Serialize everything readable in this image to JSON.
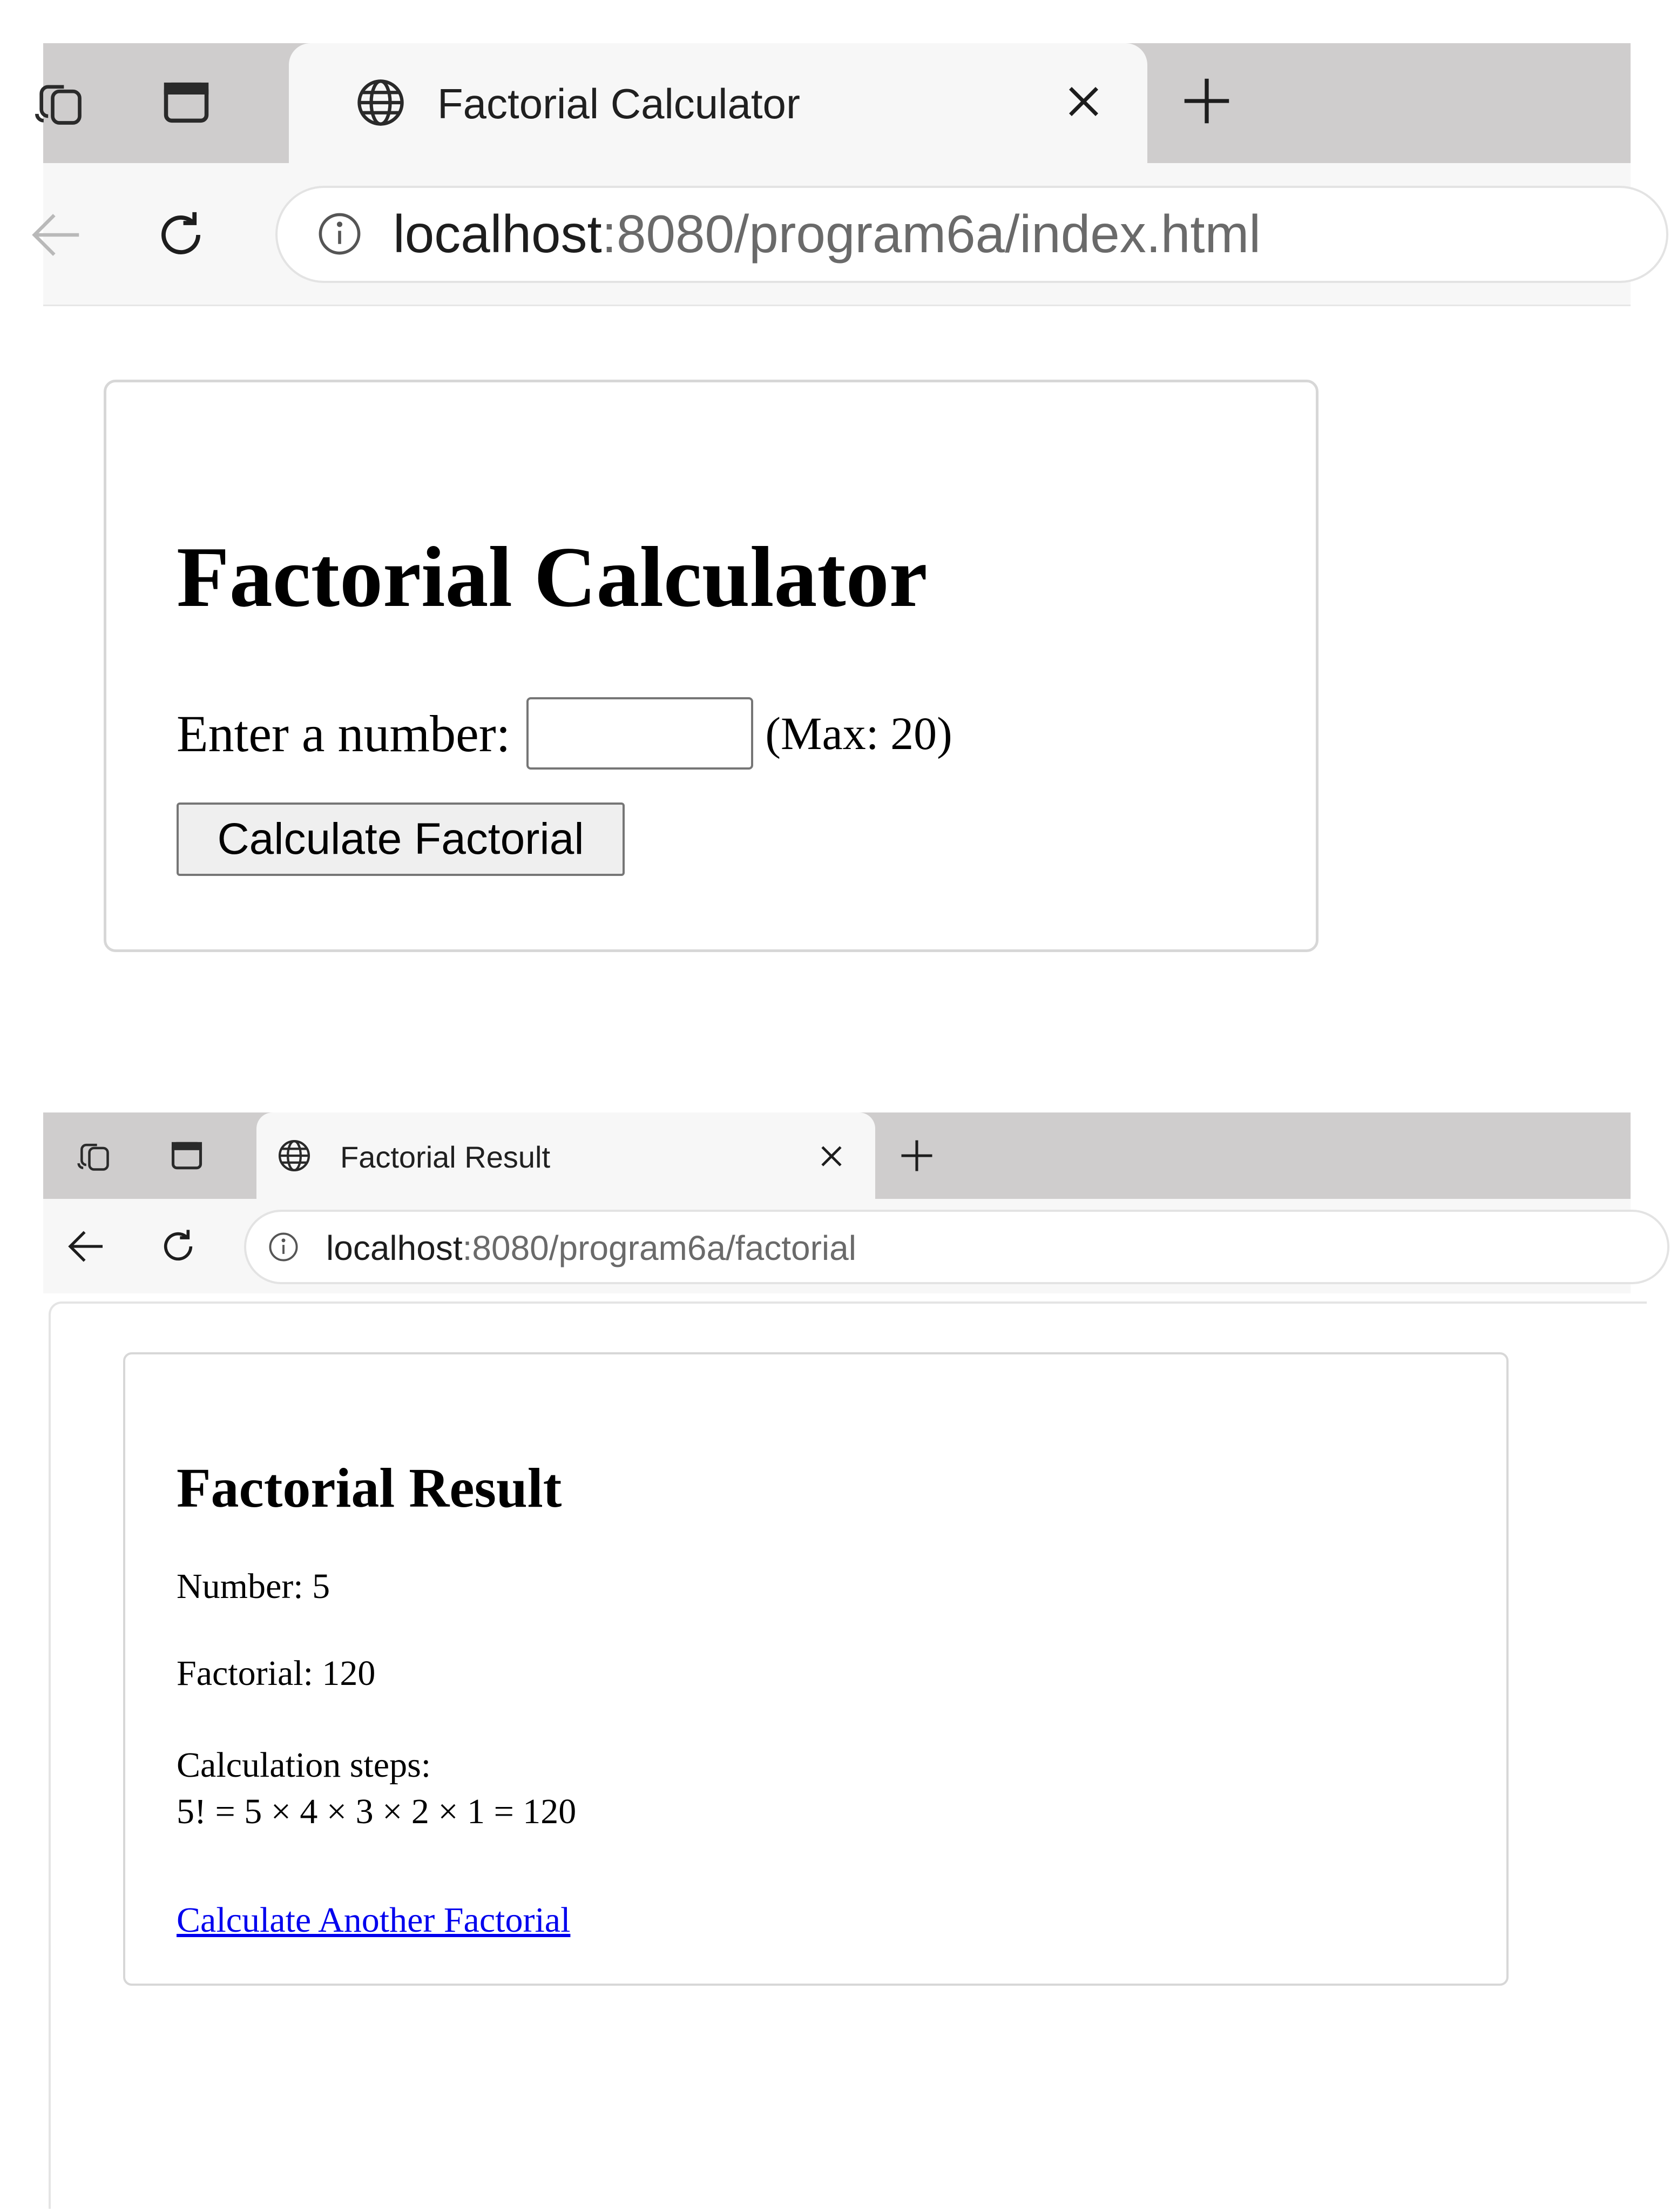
{
  "top_window": {
    "tab": {
      "title": "Factorial Calculator"
    },
    "address_bar": {
      "host": "localhost",
      "path": ":8080/program6a/index.html"
    },
    "page": {
      "heading": "Factorial Calculator",
      "input_label": "Enter a number:",
      "input_value": "",
      "max_hint": "(Max: 20)",
      "submit_label": "Calculate Factorial"
    }
  },
  "bottom_window": {
    "tab": {
      "title": "Factorial Result"
    },
    "address_bar": {
      "host": "localhost",
      "path": ":8080/program6a/factorial"
    },
    "page": {
      "heading": "Factorial Result",
      "number_line": "Number: 5",
      "factorial_line": "Factorial: 120",
      "steps_label": "Calculation steps:",
      "steps_formula": "5! = 5 × 4 × 3 × 2 × 1 = 120",
      "link_text": "Calculate Another Factorial"
    }
  },
  "icons": {
    "workspaces": "workspaces-icon",
    "tab_actions": "tab-actions-icon",
    "site": "globe-icon",
    "close_tab": "close-icon",
    "new_tab": "plus-icon",
    "back": "back-arrow-icon",
    "reload": "reload-icon",
    "site_info": "info-icon"
  },
  "colors": {
    "tabstrip": "#cfcdcd",
    "toolbar": "#f7f7f7",
    "link": "#0000ee",
    "button_face": "#efefef"
  }
}
